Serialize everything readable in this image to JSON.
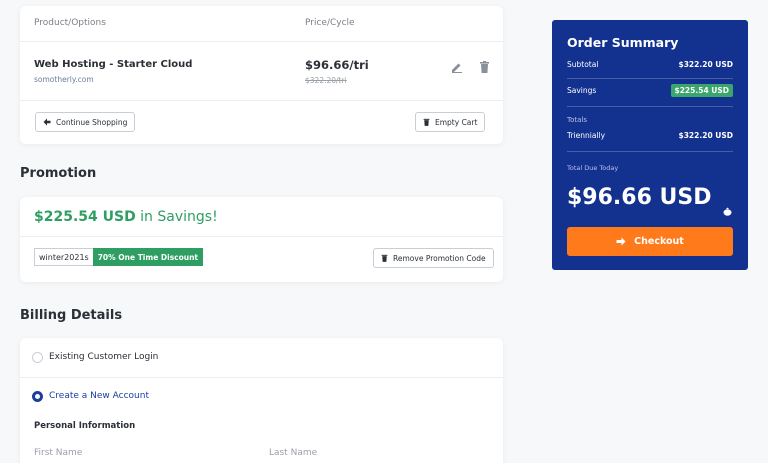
{
  "cart": {
    "headers": {
      "product": "Product/Options",
      "price": "Price/Cycle"
    },
    "item": {
      "name": "Web Hosting - Starter Cloud",
      "domain": "somotherly.com",
      "price": "$96.66/tri",
      "original_price": "$322.20/tri"
    },
    "continue_label": "Continue Shopping",
    "empty_label": "Empty Cart"
  },
  "promotion": {
    "title": "Promotion",
    "savings_amount": "$225.54 USD",
    "savings_suffix": "in Savings!",
    "code": "winter2021s",
    "discount": "70% One Time Discount",
    "remove_label": "Remove Promotion Code"
  },
  "billing": {
    "title": "Billing Details",
    "existing_label": "Existing Customer Login",
    "new_label": "Create a New Account",
    "personal_title": "Personal Information",
    "first_name_placeholder": "First Name",
    "last_name_placeholder": "Last Name"
  },
  "summary": {
    "title": "Order Summary",
    "subtotal_label": "Subtotal",
    "subtotal_value": "$322.20 USD",
    "savings_label": "Savings",
    "savings_value": "$225.54 USD",
    "totals_label": "Totals",
    "cycle_label": "Triennially",
    "cycle_value": "$322.20 USD",
    "due_label": "Total Due Today",
    "due_value": "$96.66 USD",
    "checkout_label": "Checkout"
  },
  "colors": {
    "accent_green": "#2f9e63",
    "summary_blue": "#13318e",
    "checkout_orange": "#ff7a1a"
  }
}
